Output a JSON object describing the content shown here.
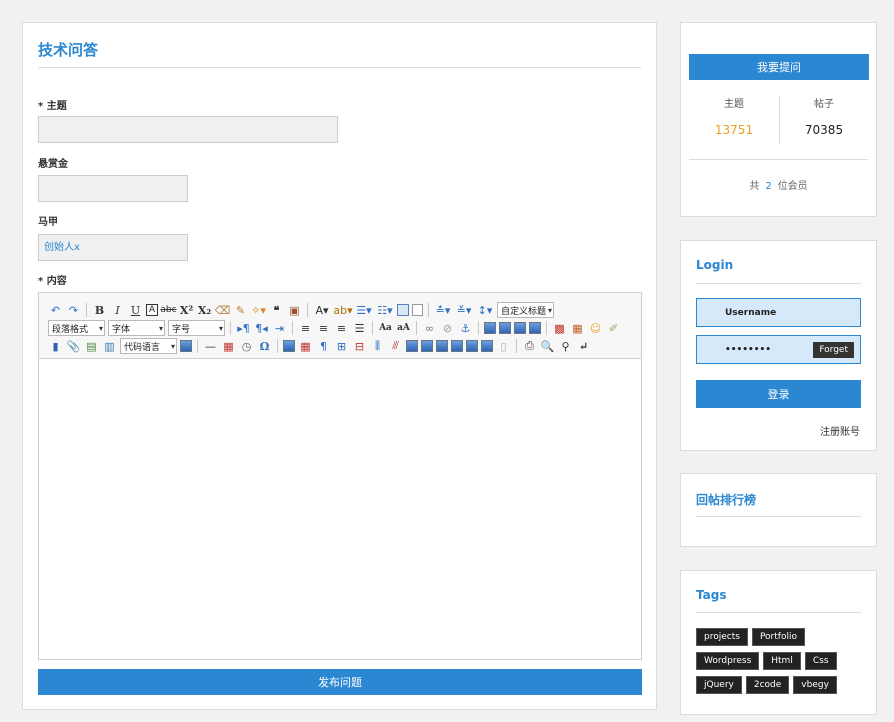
{
  "main": {
    "title": "技术问答",
    "fields": {
      "subject_label": "* 主题",
      "subject_value": "",
      "bounty_label": "悬赏金",
      "bounty_value": "",
      "alias_label": "马甲",
      "alias_value": "创始人x",
      "content_label": "* 内容"
    },
    "editor": {
      "custom_title_select": "自定义标题",
      "paragraph_select": "段落格式",
      "font_select": "字体",
      "size_select": "字号",
      "code_lang_select": "代码语言",
      "icons_row1": [
        "undo-icon",
        "redo-icon",
        "bold-icon",
        "italic-icon",
        "underline-icon",
        "font-border-icon",
        "strikethrough-icon",
        "superscript-icon",
        "subscript-icon",
        "remove-format-icon",
        "format-match-icon",
        "auto-typeset-icon",
        "blockquote-icon",
        "paste-plain-icon",
        "font-color-icon",
        "background-color-icon",
        "ordered-list-icon",
        "unordered-list-icon",
        "select-all-icon",
        "clear-doc-icon",
        "row-spacing-top-icon",
        "row-spacing-bottom-icon",
        "line-height-icon"
      ],
      "icons_row2": [
        "ltr-icon",
        "rtl-icon",
        "indent-icon",
        "justify-left-icon",
        "justify-center-icon",
        "justify-right-icon",
        "justify-full-icon",
        "touppercase-icon",
        "tolowercase-icon",
        "link-icon",
        "unlink-icon",
        "anchor-icon",
        "image-none-icon",
        "image-left-icon",
        "image-right-icon",
        "image-center-icon",
        "insert-image-icon",
        "emotion-icon",
        "scrawl-icon"
      ],
      "icons_row3": [
        "insert-video-icon",
        "attachment-icon",
        "map-icon",
        "insert-frame-icon",
        "horizontal-icon",
        "date-icon",
        "time-icon",
        "special-chars-icon",
        "insert-table-icon",
        "delete-table-icon",
        "insert-paragraph-icon",
        "insert-row-icon",
        "delete-row-icon",
        "insert-col-icon",
        "delete-col-icon",
        "merge-cells-icon",
        "merge-right-icon",
        "merge-down-icon",
        "split-to-cells-icon",
        "split-to-rows-icon",
        "split-to-cols-icon",
        "charts-icon",
        "print-icon",
        "preview-icon",
        "search-replace-icon",
        "help-icon"
      ]
    },
    "publish_label": "发布问题"
  },
  "stats": {
    "ask_label": "我要提问",
    "topics_label": "主题",
    "topics_value": "13751",
    "posts_label": "帖子",
    "posts_value": "70385",
    "members_prefix": "共",
    "members_count": "2",
    "members_suffix": "位会员",
    "topics_color": "#e8a020"
  },
  "login": {
    "title": "Login",
    "username_placeholder": "Username",
    "password_value": "••••••••",
    "forget_label": "Forget",
    "login_label": "登录",
    "register_label": "注册账号"
  },
  "rank": {
    "title": "回帖排行榜"
  },
  "tags": {
    "title": "Tags",
    "items": [
      "projects",
      "Portfolio",
      "Wordpress",
      "Html",
      "Css",
      "jQuery",
      "2code",
      "vbegy"
    ]
  },
  "colors": {
    "accent": "#2b87d1",
    "background": "#f1f1f1"
  }
}
